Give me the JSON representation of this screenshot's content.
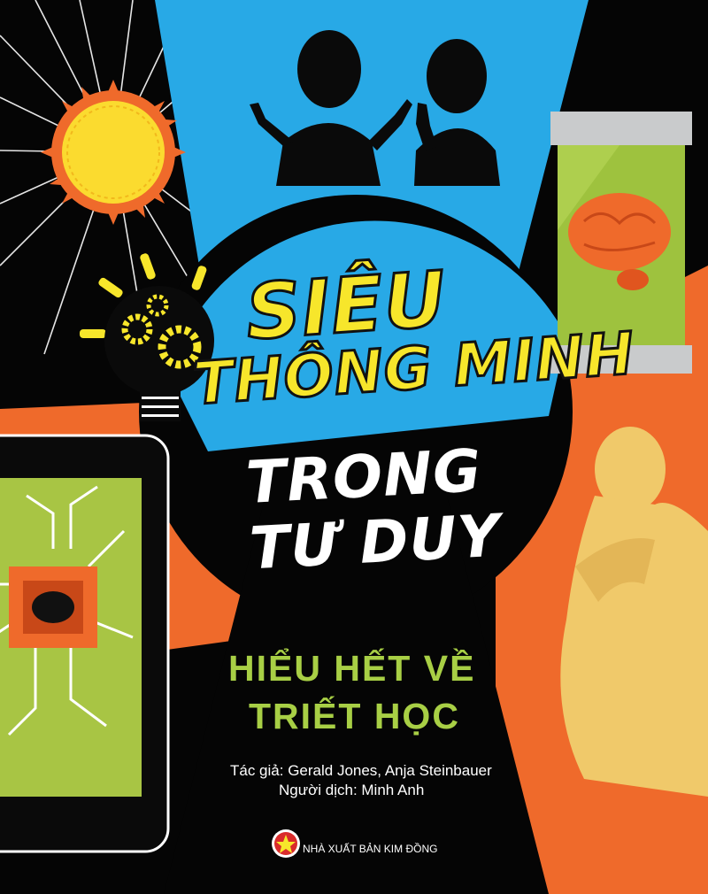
{
  "cover": {
    "title_line_1": "SIÊU",
    "title_line_2": "THÔNG MINH",
    "title_line_3": "TRONG",
    "title_line_4": "TƯ DUY",
    "subtitle_line_1": "HIỂU HẾT VỀ",
    "subtitle_line_2": "TRIẾT HỌC",
    "authors": "Tác giả: Gerald Jones, Anja Steinbauer",
    "translator": "Người dịch: Minh Anh",
    "publisher": "NHÀ XUẤT BẢN KIM ĐỒNG",
    "logo_text": "KIM ĐỒNG"
  },
  "colors": {
    "background": "#050505",
    "sky_blue": "#28a9e6",
    "orange": "#ef6a2b",
    "title_yellow": "#f7e62b",
    "subtitle_green": "#a8cf45",
    "statue_gold": "#f0c96a"
  },
  "icons": [
    "sun-icon",
    "people-silhouette-icon",
    "lightbulb-gears-icon",
    "brain-jar-icon",
    "tablet-circuit-icon",
    "thinker-statue-icon",
    "publisher-logo-icon"
  ]
}
